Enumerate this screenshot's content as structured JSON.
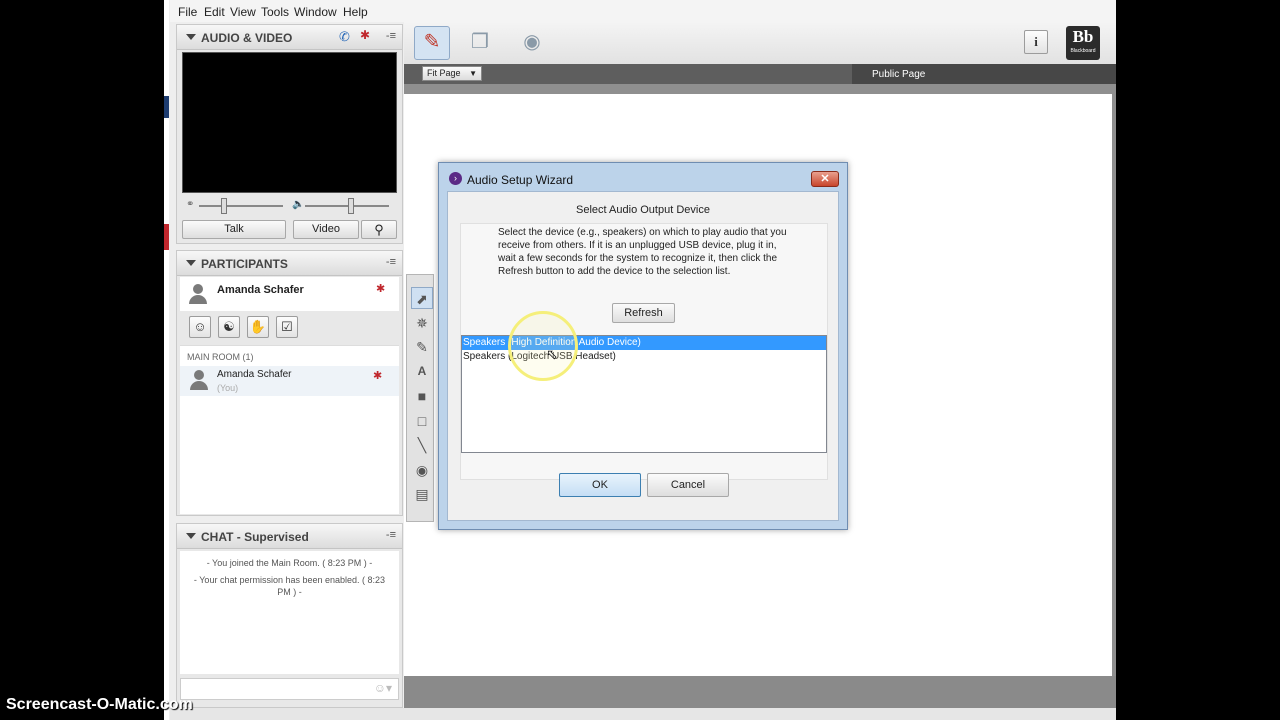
{
  "menu": [
    "File",
    "Edit",
    "View",
    "Tools",
    "Window",
    "Help"
  ],
  "audio_video": {
    "title": "AUDIO & VIDEO",
    "talk_label": "Talk",
    "video_label": "Video"
  },
  "participants": {
    "title": "PARTICIPANTS",
    "current_user": "Amanda Schafer",
    "room_label": "MAIN ROOM (1)",
    "members": [
      {
        "name": "Amanda Schafer",
        "note": "(You)"
      }
    ]
  },
  "chat": {
    "title": "CHAT - Supervised",
    "messages": [
      "- You joined the Main Room. ( 8:23 PM ) -",
      "- Your chat permission has been enabled. ( 8:23 PM ) -"
    ]
  },
  "whiteboard": {
    "zoom_select": "Fit Page",
    "page_label": "Public Page"
  },
  "brand": {
    "logo_text": "Bb",
    "logo_sub": "Blackboard"
  },
  "dialog": {
    "title": "Audio Setup Wizard",
    "heading": "Select Audio Output Device",
    "instructions": "Select the device (e.g., speakers) on which to play audio that you receive from others. If it is an unplugged USB device, plug it in, wait a few seconds for the system to recognize it, then click the Refresh button to add the device to the selection list.",
    "refresh_label": "Refresh",
    "devices": [
      "Speakers (High Definition Audio Device)",
      "Speakers (Logitech USB Headset)"
    ],
    "selected_device_index": 0,
    "ok_label": "OK",
    "cancel_label": "Cancel"
  },
  "watermark": "Screencast-O-Matic.com",
  "colors": {
    "selection": "#3399ff",
    "dialog_frame": "#bcd3ea",
    "highlight_circle": "#f5ef7a"
  }
}
